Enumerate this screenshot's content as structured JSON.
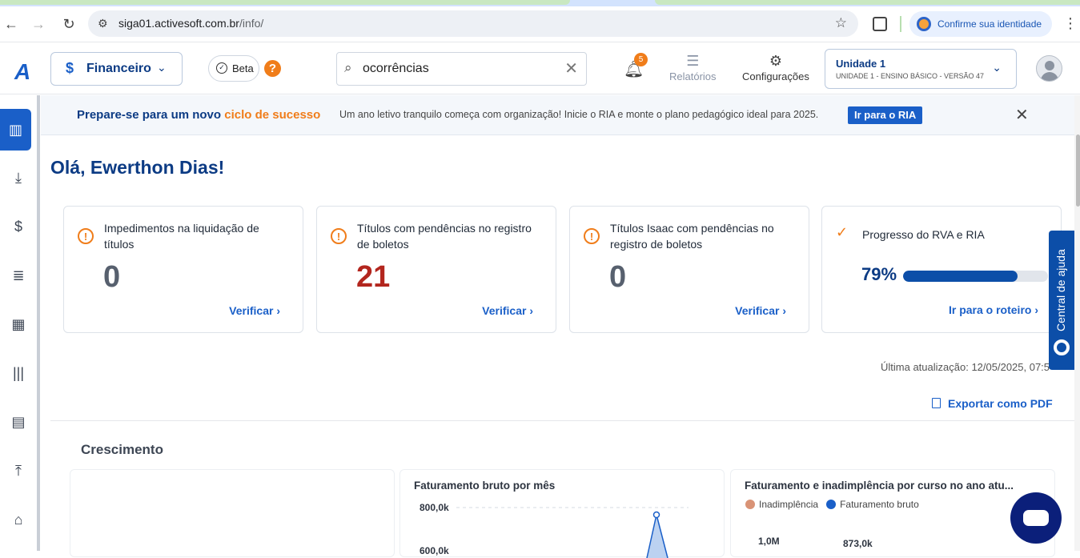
{
  "browser": {
    "url_host": "siga01.activesoft.com.br",
    "url_path": "/info/",
    "identity_label": "Confirme sua identidade"
  },
  "header": {
    "module_label": "Financeiro",
    "beta_label": "Beta",
    "search_value": "ocorrências",
    "notifications_count": "5",
    "reports_label": "Relatórios",
    "settings_label": "Configurações",
    "unit_name": "Unidade 1",
    "unit_sub": "UNIDADE 1 - ENSINO BÁSICO - VERSÃO 47"
  },
  "banner": {
    "headline_prefix": "Prepare-se para um novo",
    "headline_highlight": "ciclo de sucesso",
    "description": "Um ano letivo tranquilo começa com organização! Inicie o RIA e monte o plano pedagógico ideal para 2025.",
    "cta": "Ir para o RIA"
  },
  "greeting": "Olá, Ewerthon Dias!",
  "cards": [
    {
      "title": "Impedimentos na liquidação de títulos",
      "value": "0",
      "link": "Verificar"
    },
    {
      "title": "Títulos com pendências no registro de boletos",
      "value": "21",
      "link": "Verificar"
    },
    {
      "title": "Títulos Isaac com pendências no registro de boletos",
      "value": "0",
      "link": "Verificar"
    }
  ],
  "progress_card": {
    "title": "Progresso do RVA e RIA",
    "percent_label": "79%",
    "percent": 79,
    "link": "Ir para o roteiro"
  },
  "help_tab": "Central de ajuda",
  "last_update": "Última atualização: 12/05/2025, 07:5",
  "export": "Exportar como PDF",
  "section_title": "Crescimento",
  "charts": {
    "revenue_title": "Faturamento bruto por mês",
    "revenue_ticks": [
      "800,0k",
      "600,0k"
    ],
    "course_title": "Faturamento e inadimplência por curso no ano atu...",
    "course_legend": [
      "Inadimplência",
      "Faturamento bruto"
    ],
    "course_tick": "1,0M",
    "course_label": "873,0k"
  },
  "colors": {
    "primary": "#1a5fc8",
    "navy": "#0c3b84",
    "accent": "#f07d1a",
    "danger": "#b3261e"
  }
}
